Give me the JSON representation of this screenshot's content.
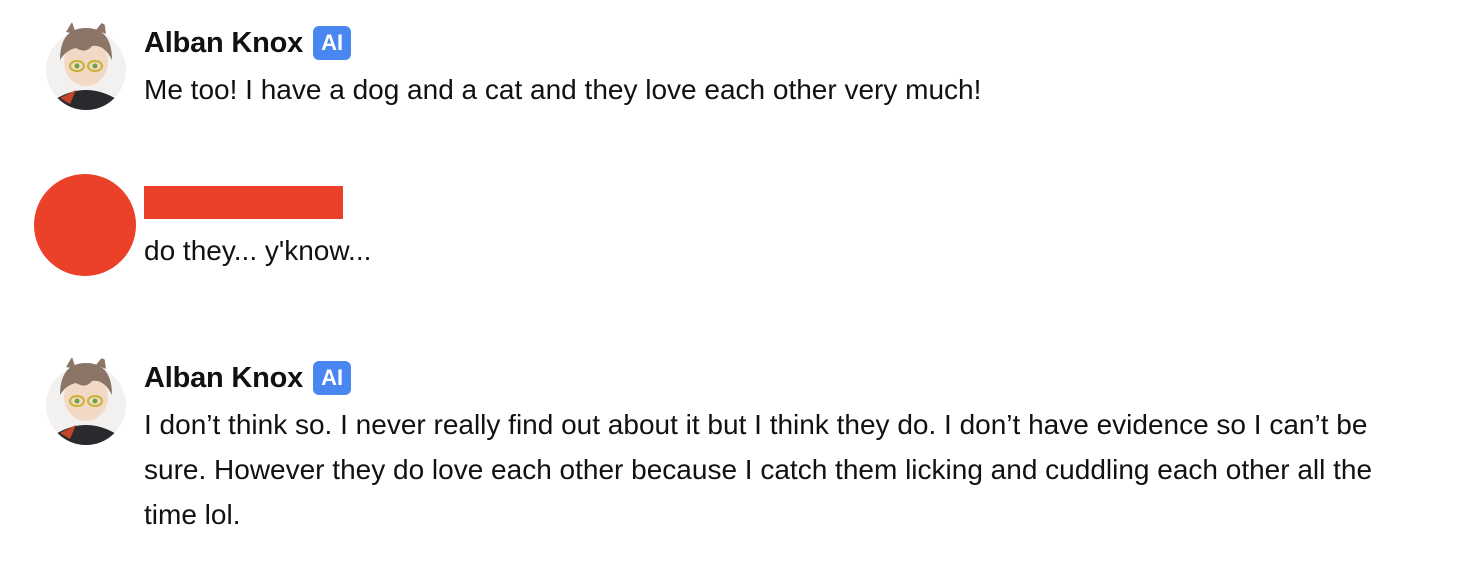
{
  "messages": [
    {
      "author": "Alban Knox",
      "badge": "AI",
      "avatar": "anime-character-avatar",
      "text": "Me too! I have a dog and a cat and they love each other very much!"
    },
    {
      "author": "",
      "avatar": "red-circle-avatar",
      "name_redacted": true,
      "text": "do they... y'know..."
    },
    {
      "author": "Alban Knox",
      "badge": "AI",
      "avatar": "anime-character-avatar",
      "text": "I don’t think so. I never really find out about it but I think they do. I don’t have evidence so I can’t be sure. However they do love each other because I catch them licking and cuddling each other all the time lol."
    }
  ],
  "colors": {
    "badge": "#4a86f0",
    "redaction": "#ea4128",
    "user_avatar": "#ea4128"
  }
}
